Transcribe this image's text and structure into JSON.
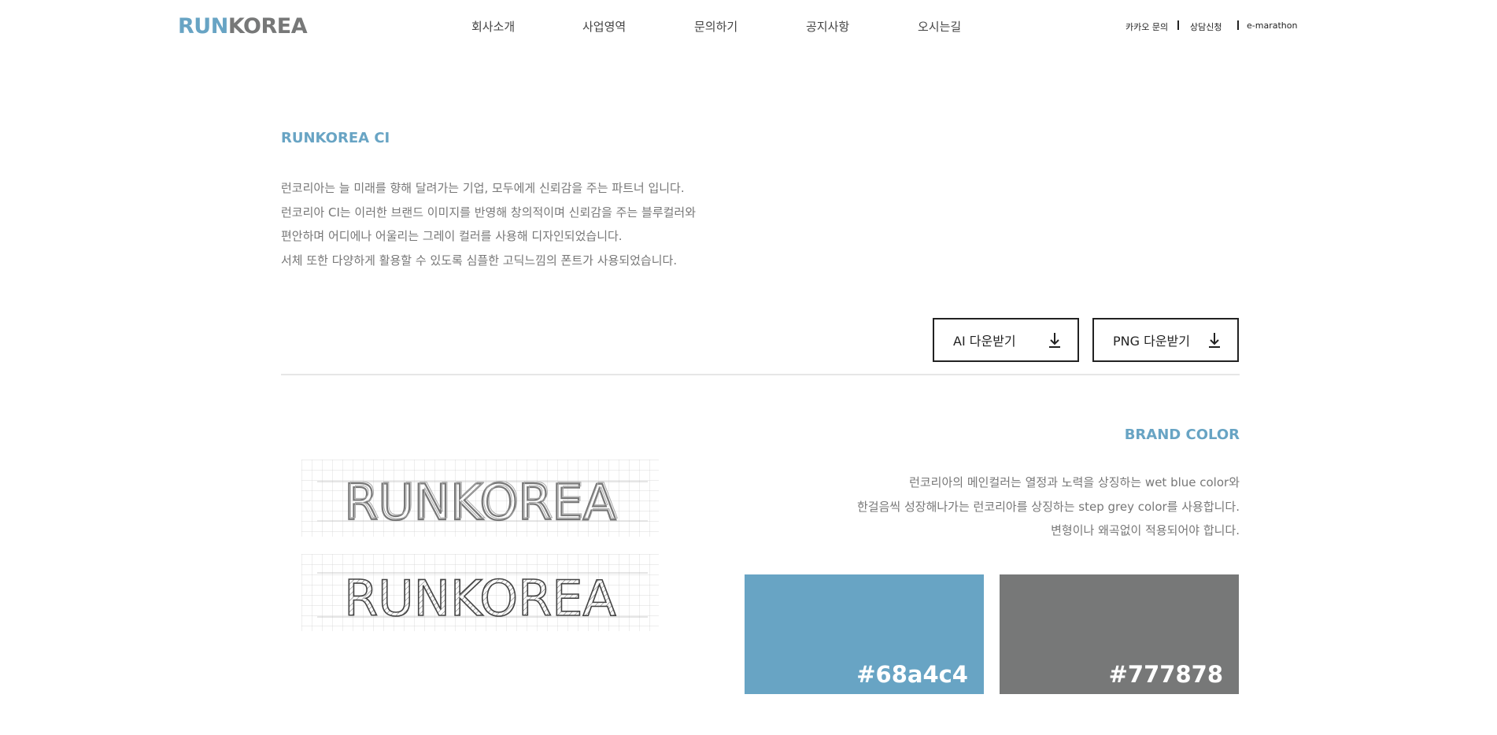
{
  "header": {
    "logo": {
      "run": "RUN",
      "korea": "KOREA"
    },
    "nav": [
      "회사소개",
      "사업영역",
      "문의하기",
      "공지사항",
      "오시는길"
    ],
    "util_links": [
      "카카오 문의",
      "상담신청",
      "e-marathon"
    ]
  },
  "ci": {
    "title": "RUNKOREA CI",
    "description": [
      "런코리아는 늘 미래를 향해 달려가는 기업, 모두에게 신뢰감을 주는 파트너 입니다.",
      "런코리아 CI는 이러한 브랜드 이미지를 반영해 창의적이며 신뢰감을 주는 블루컬러와",
      "편안하며 어디에나 어울리는 그레이 컬러를 사용해 디자인되었습니다.",
      "서체 또한 다양하게 활용할 수 있도록 심플한 고딕느낌의 폰트가 사용되었습니다."
    ],
    "buttons": {
      "ai": "AI 다운받기",
      "png": "PNG 다운받기"
    },
    "sketch_logo_text": "RUNKOREA"
  },
  "brand_color": {
    "title": "BRAND COLOR",
    "description": [
      "런코리아의 메인컬러는 열정과 노력을 상징하는 wet blue color와",
      "한걸음씩 성장해나가는 런코리아를 상징하는 step grey color를 사용합니다.",
      "변형이나 왜곡없이 적용되어야 합니다."
    ],
    "swatches": [
      {
        "hex_label": "#68a4c4",
        "color": "#68a4c4"
      },
      {
        "hex_label": "#777878",
        "color": "#777878"
      }
    ]
  }
}
